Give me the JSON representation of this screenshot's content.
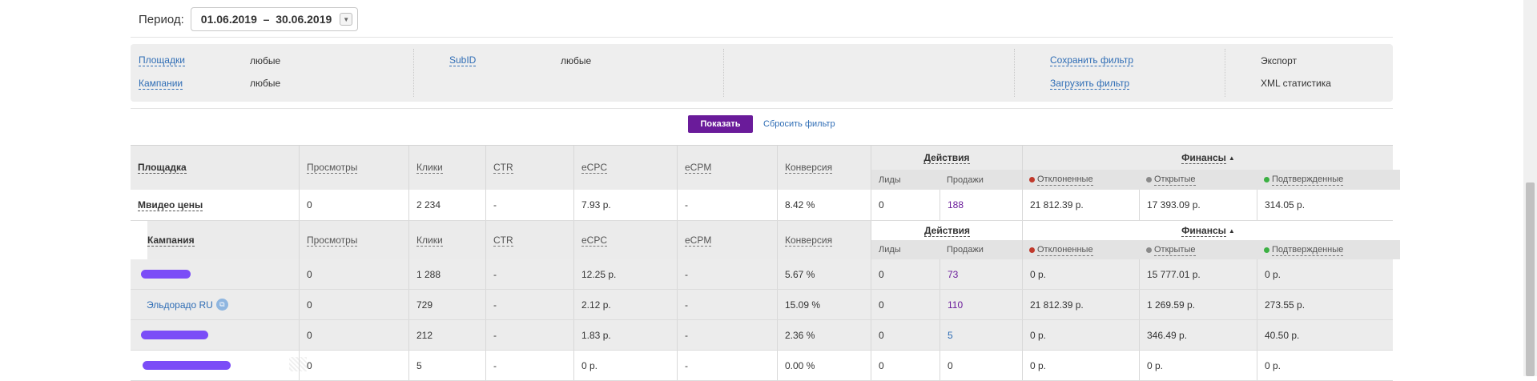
{
  "period": {
    "label": "Период:",
    "value": "01.06.2019  –  30.06.2019"
  },
  "filters": {
    "placements_link": "Площадки",
    "placements_value": "любые",
    "campaigns_link": "Кампании",
    "campaigns_value": "любые",
    "subid_link": "SubID",
    "subid_value": "любые",
    "save_filter": "Сохранить фильтр",
    "load_filter": "Загрузить фильтр",
    "export": "Экспорт",
    "xml_stats": "XML статистика"
  },
  "actions": {
    "show": "Показать",
    "reset": "Сбросить фильтр"
  },
  "table": {
    "col_placement": "Площадка",
    "col_campaign": "Кампания",
    "cols": {
      "views": "Просмотры",
      "clicks": "Клики",
      "ctr": "CTR",
      "ecpc": "eCPC",
      "ecpm": "eCPM",
      "conversion": "Конверсия"
    },
    "group_actions": "Действия",
    "group_finance": "Финансы",
    "sub_leads": "Лиды",
    "sub_sales": "Продажи",
    "sub_rejected": "Отклоненные",
    "sub_open": "Открытые",
    "sub_confirmed": "Подтвержденные",
    "placement_row": {
      "name": "Мвидео цены",
      "views": "0",
      "clicks": "2 234",
      "ctr": "-",
      "ecpc": "7.93 р.",
      "ecpm": "-",
      "conversion": "8.42 %",
      "leads": "0",
      "sales": "188",
      "rejected": "21 812.39 р.",
      "open": "17 393.09 р.",
      "confirmed": "314.05 р."
    },
    "campaign_rows": [
      {
        "name": "",
        "views": "0",
        "clicks": "1 288",
        "ctr": "-",
        "ecpc": "12.25 р.",
        "ecpm": "-",
        "conversion": "5.67 %",
        "leads": "0",
        "sales": "73",
        "rejected": "0 р.",
        "open": "15 777.01 р.",
        "confirmed": "0 р."
      },
      {
        "name": "Эльдорадо RU",
        "views": "0",
        "clicks": "729",
        "ctr": "-",
        "ecpc": "2.12 р.",
        "ecpm": "-",
        "conversion": "15.09 %",
        "leads": "0",
        "sales": "110",
        "rejected": "21 812.39 р.",
        "open": "1 269.59 р.",
        "confirmed": "273.55 р."
      },
      {
        "name": "",
        "views": "0",
        "clicks": "212",
        "ctr": "-",
        "ecpc": "1.83 р.",
        "ecpm": "-",
        "conversion": "2.36 %",
        "leads": "0",
        "sales": "5",
        "rejected": "0 р.",
        "open": "346.49 р.",
        "confirmed": "40.50 р."
      },
      {
        "name": "",
        "views": "0",
        "clicks": "5",
        "ctr": "-",
        "ecpc": "0 р.",
        "ecpm": "-",
        "conversion": "0.00 %",
        "leads": "0",
        "sales": "0",
        "rejected": "0 р.",
        "open": "0 р.",
        "confirmed": "0 р."
      }
    ]
  },
  "colors": {
    "accent": "#6a1b9a",
    "link": "#2f6db5",
    "rejected": "#c0392b",
    "open": "#8a8a8a",
    "confirmed": "#3cb043",
    "redaction": "#7b4df7"
  },
  "icons": {
    "dropdown": "chevron-down-icon",
    "campaign_link": "external-link-icon",
    "sort": "sort-up-icon"
  }
}
